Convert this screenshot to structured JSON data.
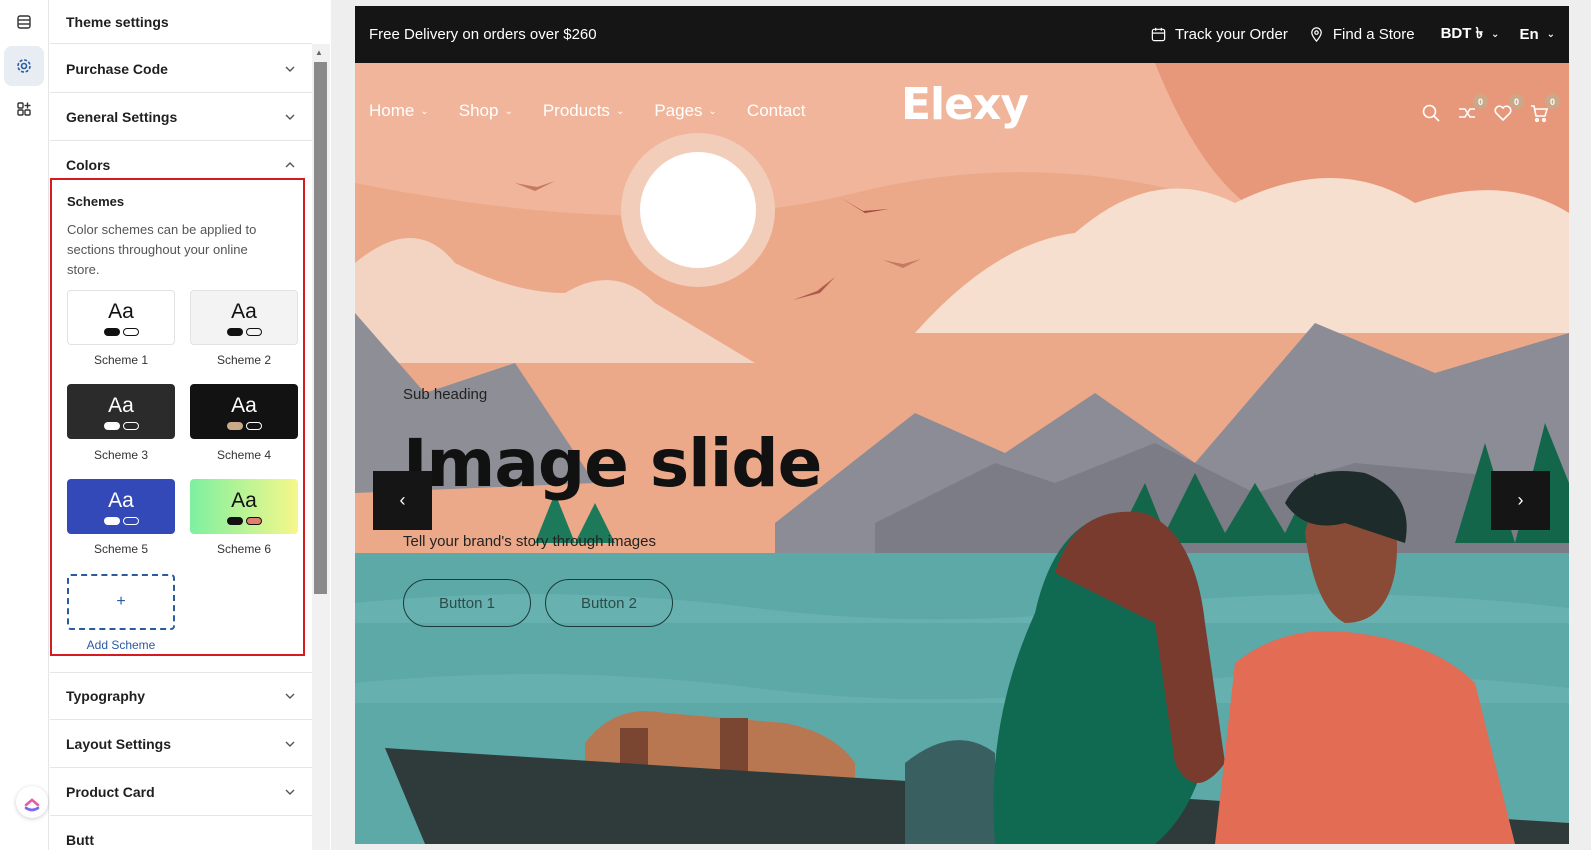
{
  "sidebar": {
    "title": "Theme settings",
    "sections": {
      "purchase_code": "Purchase Code",
      "general_settings": "General Settings",
      "colors": "Colors",
      "typography": "Typography",
      "layout_settings": "Layout Settings",
      "product_card": "Product Card",
      "partial_next": "Butt"
    },
    "colors": {
      "schemes_title": "Schemes",
      "schemes_desc": "Color schemes can be applied to sections throughout your online store.",
      "swatch_text": "Aa",
      "add_icon": "+",
      "add_label": "Add Scheme",
      "schemes": [
        {
          "label": "Scheme 1",
          "bg": "#ffffff",
          "fg": "#111111"
        },
        {
          "label": "Scheme 2",
          "bg": "#f3f3f3",
          "fg": "#111111"
        },
        {
          "label": "Scheme 3",
          "bg": "#2b2b2b",
          "fg": "#ffffff"
        },
        {
          "label": "Scheme 4",
          "bg": "#121212",
          "fg": "#ffffff"
        },
        {
          "label": "Scheme 5",
          "bg": "#3349b8",
          "fg": "#ffffff"
        },
        {
          "label": "Scheme 6",
          "bg": "linear-gradient(90deg,#7ef0a0,#f6f78a)",
          "fg": "#111111"
        }
      ]
    }
  },
  "preview": {
    "topbar": {
      "announcement": "Free Delivery on orders over $260",
      "track_order": "Track your Order",
      "find_store": "Find a Store",
      "currency": "BDT ৳",
      "language": "En"
    },
    "nav": [
      "Home",
      "Shop",
      "Products",
      "Pages",
      "Contact"
    ],
    "logo": "Elexy",
    "badges": {
      "compare": "0",
      "wishlist": "0",
      "cart": "0"
    },
    "slide": {
      "sub_heading": "Sub heading",
      "title": "Image slide",
      "description": "Tell your brand's story through images",
      "button1": "Button 1",
      "button2": "Button 2"
    },
    "arrows": {
      "prev": "‹",
      "next": "›"
    }
  },
  "colors": {
    "accent_red": "#d71920",
    "link_blue": "#2a5aa0",
    "topbar": "#151515",
    "badge": "#c9a98a"
  }
}
